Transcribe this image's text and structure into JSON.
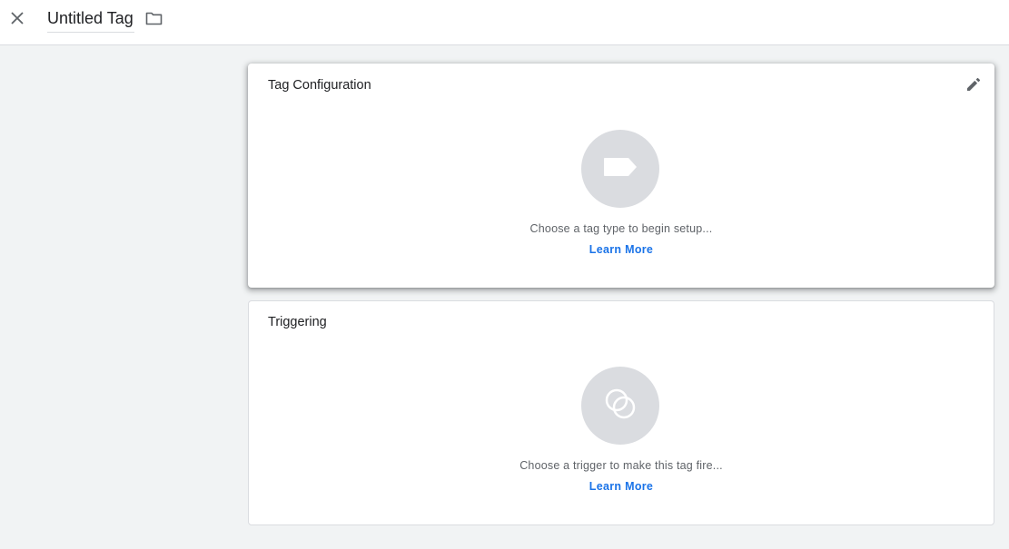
{
  "header": {
    "title": "Untitled Tag",
    "close_icon": "close-icon",
    "folder_icon": "folder-icon"
  },
  "tag_configuration": {
    "title": "Tag Configuration",
    "edit_icon": "pencil-icon",
    "placeholder_icon": "tag-icon",
    "hint": "Choose a tag type to begin setup...",
    "learn_more": "Learn More"
  },
  "triggering": {
    "title": "Triggering",
    "placeholder_icon": "trigger-icon",
    "hint": "Choose a trigger to make this tag fire...",
    "learn_more": "Learn More"
  },
  "colors": {
    "background": "#f1f3f4",
    "card": "#ffffff",
    "icon_circle": "#dadce0",
    "link": "#1a73e8",
    "muted_text": "#5f6368"
  }
}
